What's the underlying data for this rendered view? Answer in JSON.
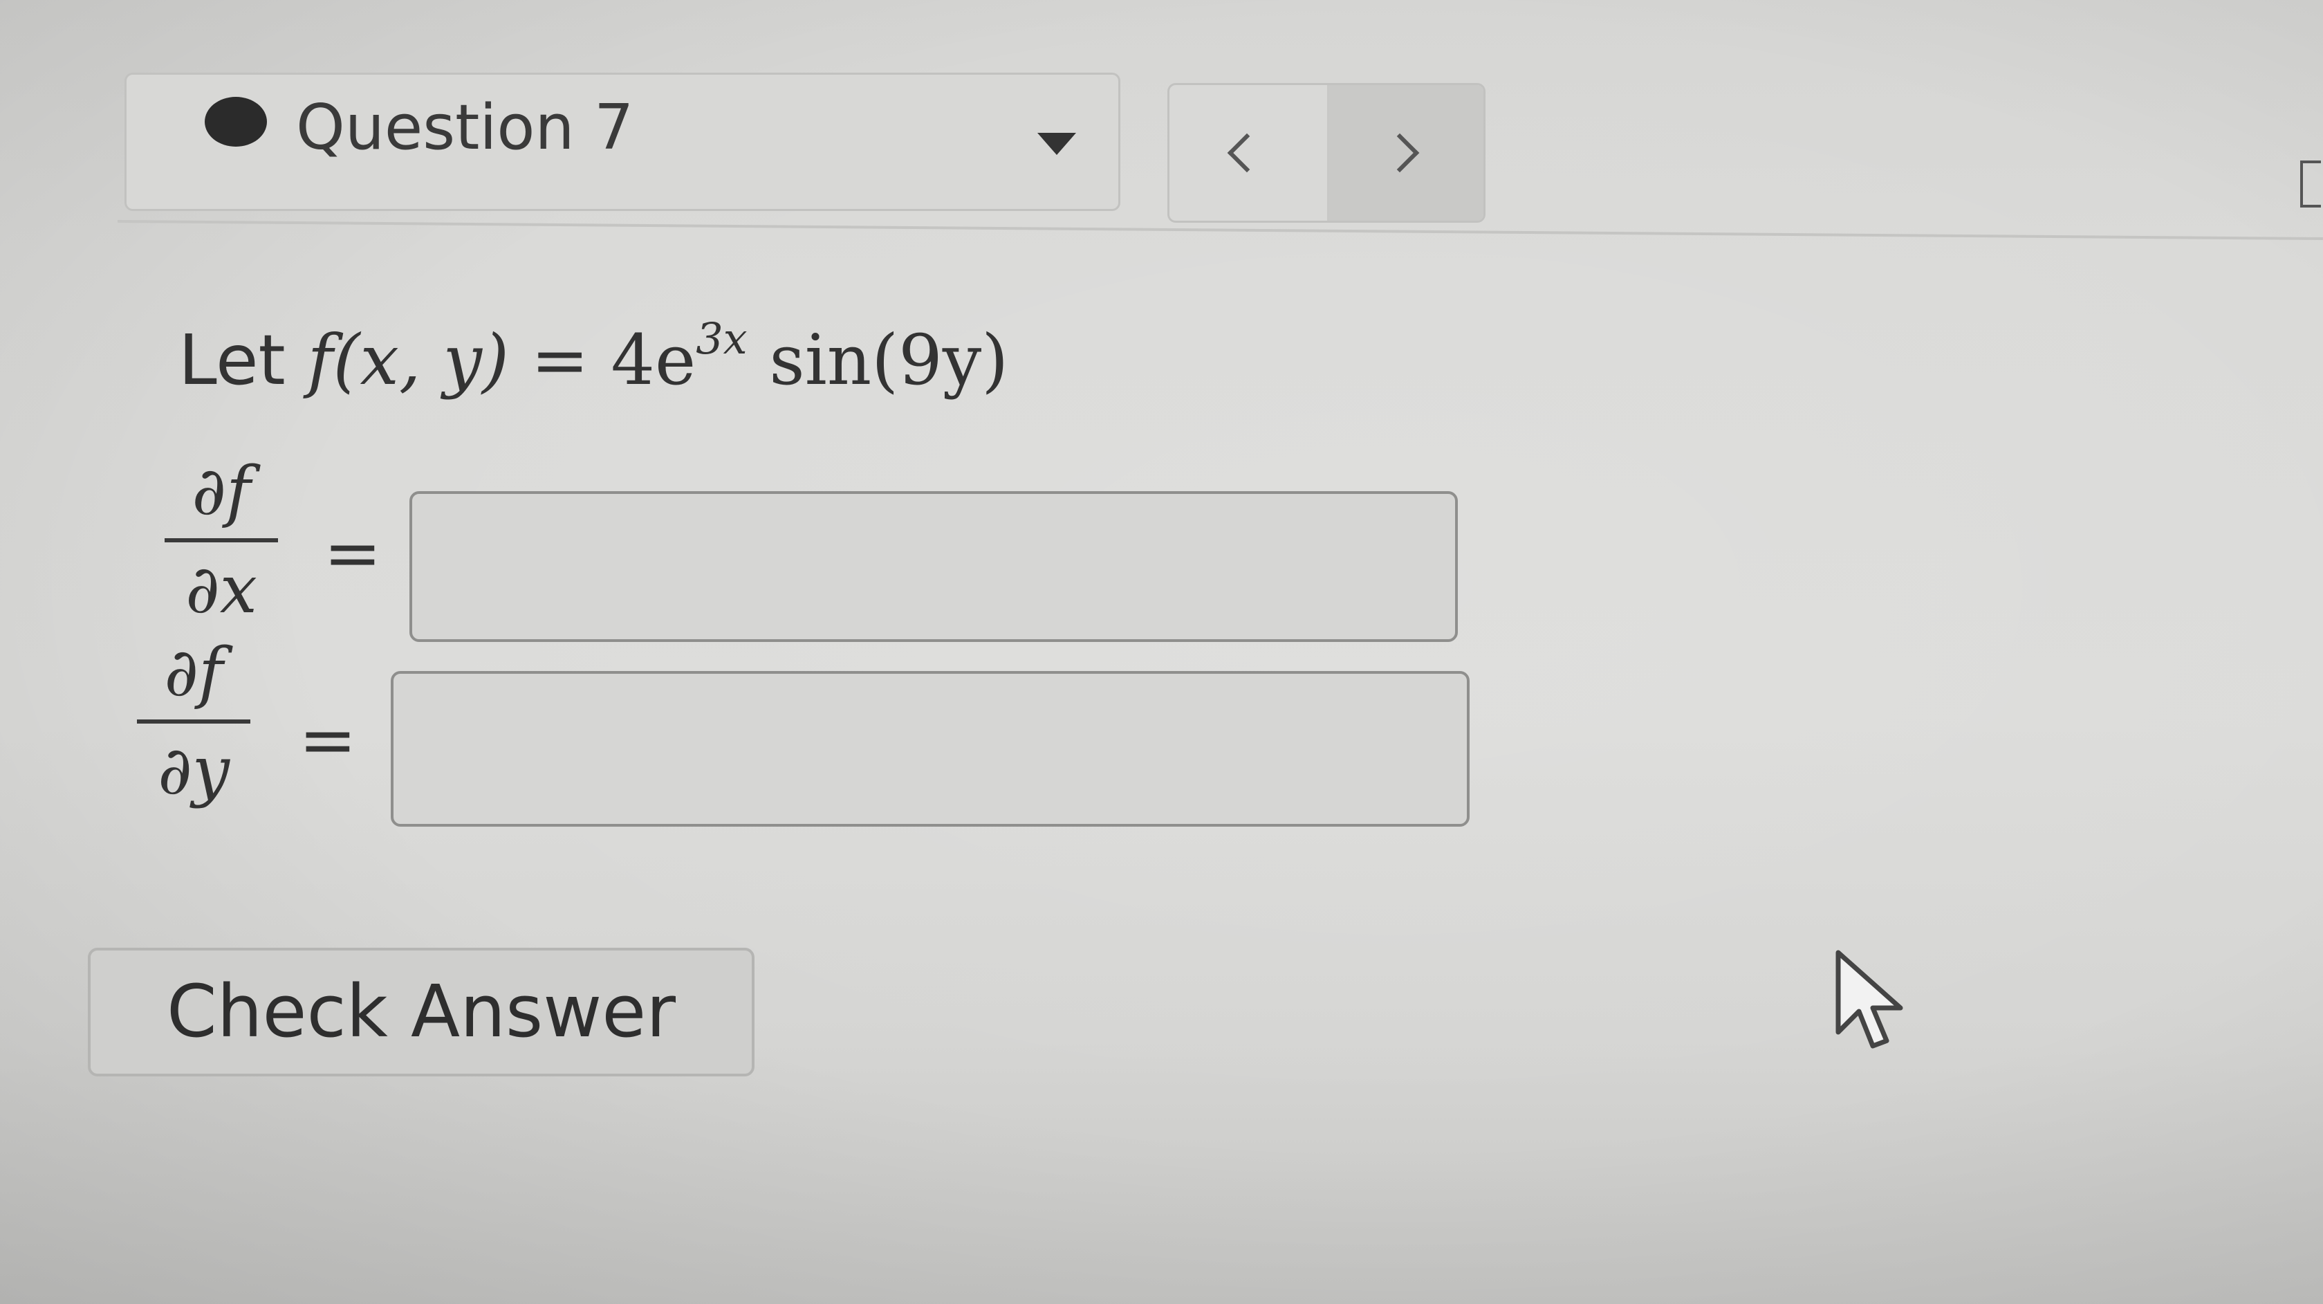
{
  "header": {
    "question_title": "Question 7",
    "status_icon": "filled-circle",
    "dropdown_icon": "triangle-down-icon",
    "nav": {
      "prev_icon": "chevron-left-icon",
      "next_icon": "chevron-right-icon"
    }
  },
  "question": {
    "prefix": "Let",
    "function_lhs": "f(x, y)",
    "equals": "=",
    "coefficient": "4e",
    "exponent": "3x",
    "function_rhs_tail": " sin(9y)"
  },
  "answers": [
    {
      "numerator": "∂f",
      "denominator": "∂x",
      "equals": "=",
      "value": ""
    },
    {
      "numerator": "∂f",
      "denominator": "∂y",
      "equals": "=",
      "value": ""
    }
  ],
  "actions": {
    "check_answer_label": "Check Answer"
  },
  "pointer": {
    "icon": "mouse-pointer-icon"
  },
  "colors": {
    "background": "#d9d9d7",
    "text": "#333333",
    "field_border": "#8f8f8d",
    "button_background": "#cfcfcd"
  }
}
